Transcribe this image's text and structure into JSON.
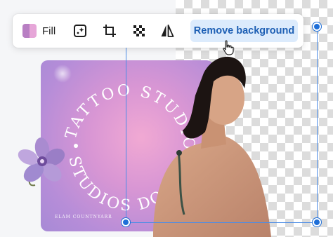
{
  "toolbar": {
    "fill_label": "Fill",
    "fill_colors": [
      "#b87fc3",
      "#e6a6d8"
    ],
    "tools": [
      {
        "name": "ai-edit-icon"
      },
      {
        "name": "crop-icon"
      },
      {
        "name": "transparency-icon"
      },
      {
        "name": "flip-icon"
      }
    ],
    "remove_bg_label": "Remove background"
  },
  "card": {
    "ring_text_top": "TATTOO STUDIO",
    "ring_text_bottom": "STUDIOS DO",
    "footer_text": "ELAM COUNTNYARR"
  },
  "colors": {
    "accent": "#1f6fd8",
    "button_bg": "#dcebfc",
    "button_text": "#1d5fb4"
  }
}
